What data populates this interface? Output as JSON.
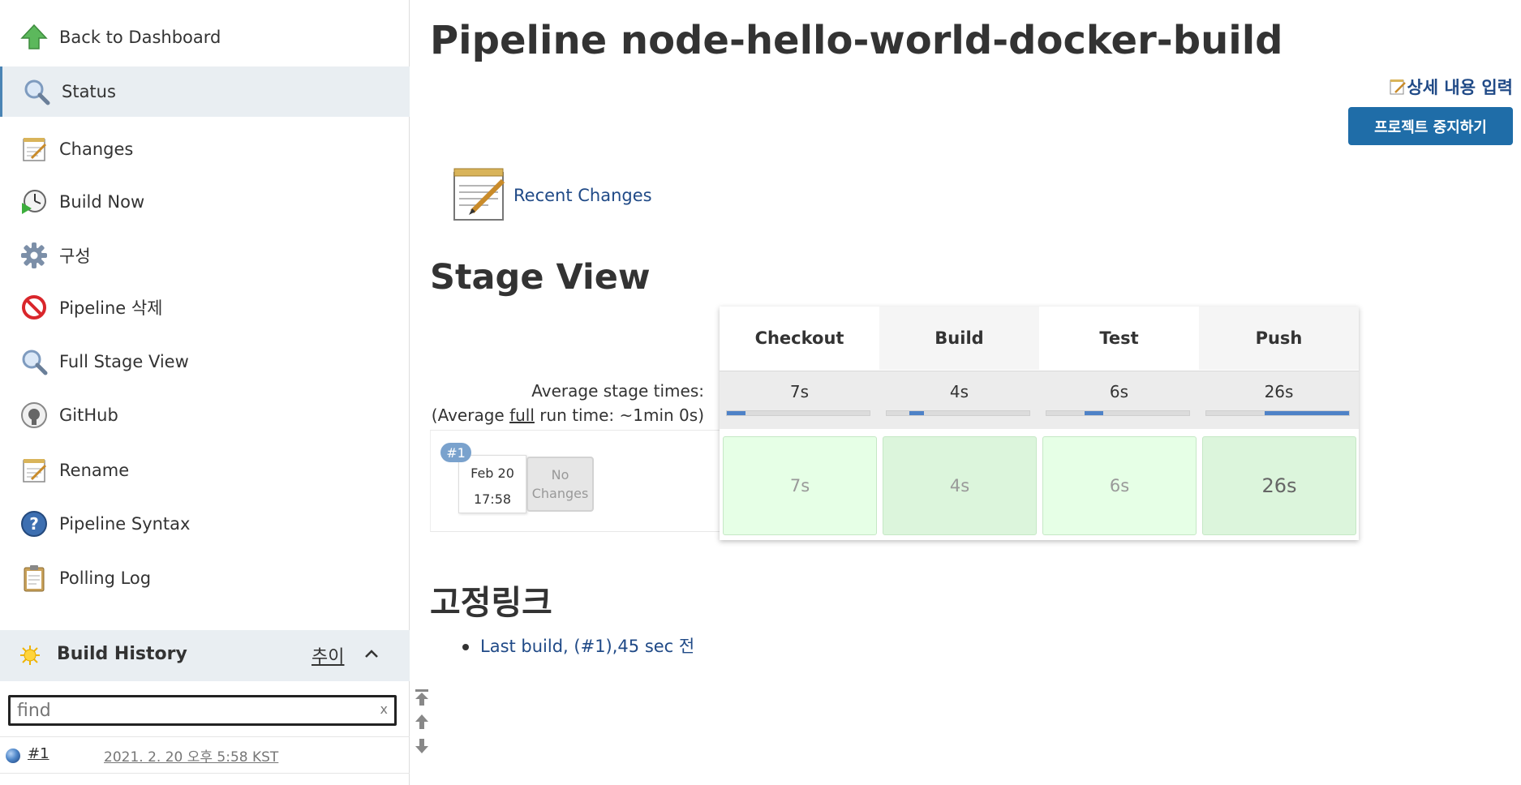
{
  "sidebar": {
    "tasks": [
      {
        "label": "Back to Dashboard",
        "icon": "up-arrow-icon"
      },
      {
        "label": "Status",
        "icon": "magnifier-icon"
      },
      {
        "label": "Changes",
        "icon": "notepad-icon"
      },
      {
        "label": "Build Now",
        "icon": "clock-play-icon"
      },
      {
        "label": "구성",
        "icon": "gear-icon"
      },
      {
        "label": "Pipeline 삭제",
        "icon": "no-entry-icon"
      },
      {
        "label": "Full Stage View",
        "icon": "magnifier-icon"
      },
      {
        "label": "GitHub",
        "icon": "github-icon"
      },
      {
        "label": "Rename",
        "icon": "notepad-icon"
      },
      {
        "label": "Pipeline Syntax",
        "icon": "help-icon"
      },
      {
        "label": "Polling Log",
        "icon": "clipboard-icon"
      }
    ],
    "build_history": {
      "title": "Build History",
      "trend_label": "추이",
      "search_placeholder": "find",
      "search_clear": "x",
      "builds": [
        {
          "number": "#1",
          "date": "2021. 2. 20 오후 5:58 KST"
        }
      ]
    }
  },
  "main": {
    "title": "Pipeline node-hello-world-docker-build",
    "edit_description_label": "상세 내용 입력",
    "disable_project_label": "프로젝트 중지하기",
    "recent_changes_label": "Recent Changes",
    "stage_view_heading": "Stage View",
    "avg_stage_times_label": "Average stage times:",
    "avg_run_time_prefix": "(Average ",
    "avg_run_time_full": "full",
    "avg_run_time_suffix": " run time: ~1min 0s)",
    "stages": [
      {
        "name": "Checkout",
        "avg": "7s",
        "run": "7s"
      },
      {
        "name": "Build",
        "avg": "4s",
        "run": "4s"
      },
      {
        "name": "Test",
        "avg": "6s",
        "run": "6s"
      },
      {
        "name": "Push",
        "avg": "26s",
        "run": "26s"
      }
    ],
    "run": {
      "badge": "#1",
      "date": "Feb 20",
      "time": "17:58",
      "no_changes_line1": "No",
      "no_changes_line2": "Changes"
    },
    "permalinks_heading": "고정링크",
    "permalinks": [
      "Last build, (#1),45 sec 전"
    ]
  },
  "colors": {
    "link": "#204a87",
    "button": "#1f6da8",
    "stage_success": "#e6ffe6",
    "active_task_bg": "#e9eef2",
    "progress_fill": "#4e82c7"
  }
}
